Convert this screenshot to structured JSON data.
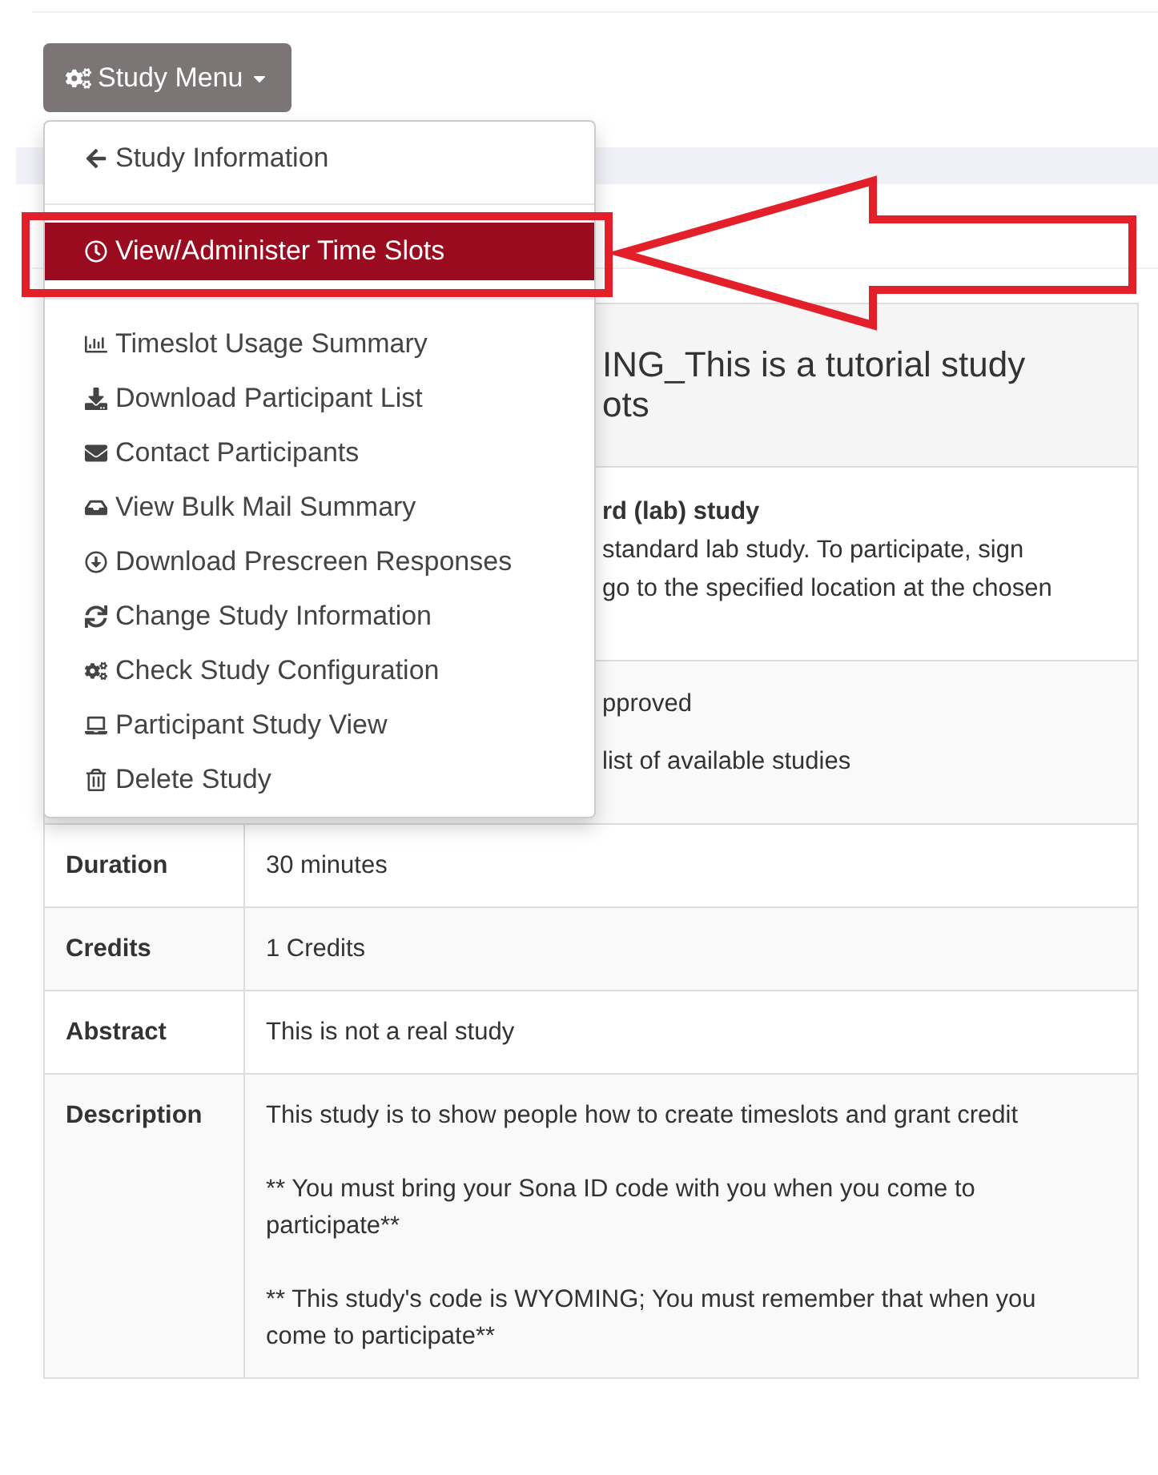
{
  "study_menu_button": {
    "label": "Study Menu"
  },
  "menu": {
    "groups": [
      {
        "items": [
          {
            "label": "Study Information",
            "selected": false
          }
        ]
      },
      {
        "items": [
          {
            "label": "View/Administer Time Slots",
            "selected": true
          }
        ]
      },
      {
        "items": [
          {
            "label": "Timeslot Usage Summary",
            "selected": false
          },
          {
            "label": "Download Participant List",
            "selected": false
          },
          {
            "label": "Contact Participants",
            "selected": false
          },
          {
            "label": "View Bulk Mail Summary",
            "selected": false
          },
          {
            "label": "Download Prescreen Responses",
            "selected": false
          },
          {
            "label": "Change Study Information",
            "selected": false
          },
          {
            "label": "Check Study Configuration",
            "selected": false
          },
          {
            "label": "Participant Study View",
            "selected": false
          },
          {
            "label": "Delete Study",
            "selected": false
          }
        ]
      }
    ]
  },
  "table": {
    "title_fragments": [
      "ING_This is a tutorial study",
      "ots"
    ],
    "partial_rows": [
      {
        "lines": [
          {
            "text": "rd (lab) study",
            "bold": true
          },
          {
            "text": "standard lab study. To participate, sign",
            "bold": false
          },
          {
            "text": "go to the specified location at the chosen",
            "bold": false
          }
        ]
      },
      {
        "lines": [
          {
            "text": "pproved",
            "bold": false
          },
          {
            "text": "list of available studies",
            "bold": false
          }
        ]
      }
    ],
    "rows": [
      {
        "label": "Duration",
        "paragraphs": [
          "30 minutes"
        ]
      },
      {
        "label": "Credits",
        "paragraphs": [
          "1 Credits"
        ]
      },
      {
        "label": "Abstract",
        "paragraphs": [
          "This is not a real study"
        ]
      },
      {
        "label": "Description",
        "paragraphs": [
          "This study is to show people how to create timeslots and grant credit",
          "** You must bring your Sona ID code with you when you come to participate**",
          "** This study's code is WYOMING; You must remember that when you come to participate**"
        ]
      }
    ]
  }
}
